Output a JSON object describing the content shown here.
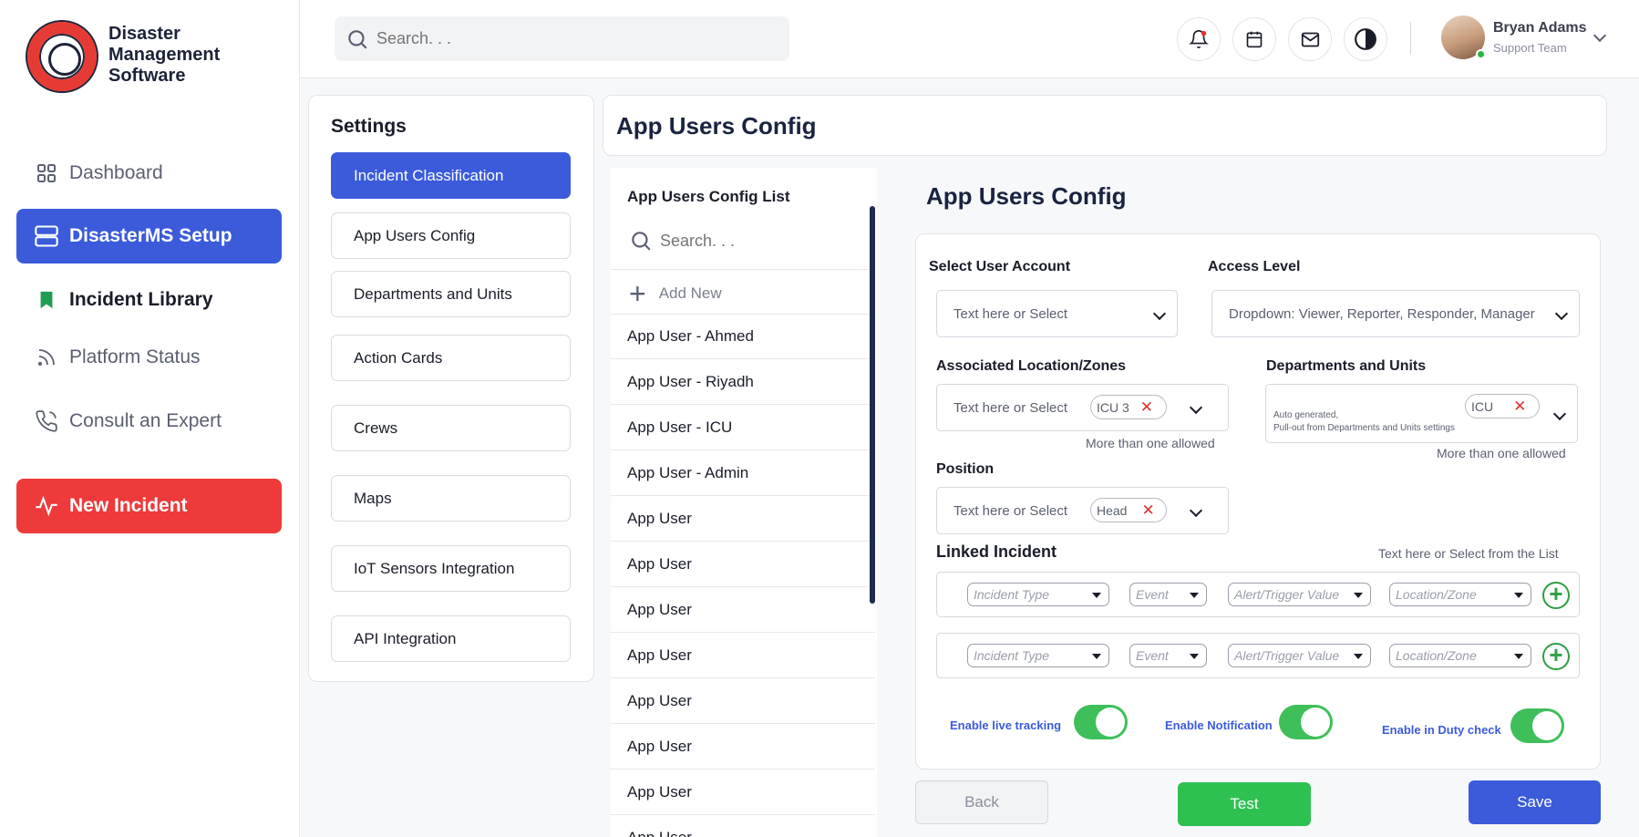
{
  "app": {
    "logo_line1": "Disaster",
    "logo_line2": "Management",
    "logo_line3": "Software"
  },
  "sidebar": {
    "items": [
      {
        "label": "Dashboard",
        "icon": "grid-icon"
      },
      {
        "label": "DisasterMS Setup",
        "icon": "server-icon"
      },
      {
        "label": "Incident Library",
        "icon": "bookmark-icon"
      },
      {
        "label": "Platform Status",
        "icon": "rss-icon"
      },
      {
        "label": "Consult an Expert",
        "icon": "phone-icon"
      },
      {
        "label": "New Incident",
        "icon": "activity-icon"
      }
    ]
  },
  "topbar": {
    "search_placeholder": "Search. . .",
    "user_name": "Bryan Adams",
    "user_role": "Support Team"
  },
  "settings": {
    "title": "Settings",
    "items": [
      "Incident Classification",
      "App Users Config",
      "Departments and Units",
      "Action Cards",
      "Crews",
      "Maps",
      "IoT Sensors Integration",
      "API Integration"
    ]
  },
  "page": {
    "title": "App Users Config"
  },
  "list": {
    "title": "App Users Config List",
    "search_placeholder": "Search. . .",
    "add_label": "Add New",
    "rows": [
      "App User - Ahmed",
      "App User - Riyadh",
      "App User - ICU",
      "App User - Admin",
      "App User",
      "App User",
      "App User",
      "App User",
      "App User",
      "App User",
      "App User",
      "App User"
    ]
  },
  "form": {
    "title": "App Users Config",
    "select_user_label": "Select User Account",
    "select_user_value": "Text here or Select",
    "access_label": "Access Level",
    "access_value": "Dropdown: Viewer, Reporter, Responder, Manager",
    "location_label": "Associated Location/Zones",
    "location_value": "Text here or Select",
    "location_chip": "ICU 3",
    "location_hint": "More than one allowed",
    "dept_label": "Departments and Units",
    "dept_note1": "Auto generated,",
    "dept_note2": "Pull-out from Departments and Units settings",
    "dept_chip": "ICU",
    "dept_hint": "More than one allowed",
    "position_label": "Position",
    "position_value": "Text here or Select",
    "position_chip": "Head",
    "linked_label": "Linked Incident",
    "linked_hint": "Text here or Select from the List",
    "linked_fields": [
      "Incident Type",
      "Event",
      "Alert/Trigger Value",
      "Location/Zone"
    ],
    "toggle_tracking": "Enable live tracking",
    "toggle_notification": "Enable Notification",
    "toggle_duty": "Enable in Duty check",
    "back_label": "Back",
    "test_label": "Test",
    "save_label": "Save"
  },
  "colors": {
    "primary": "#3b5bdb",
    "danger": "#ee3a3a",
    "success": "#3fbf5a"
  }
}
